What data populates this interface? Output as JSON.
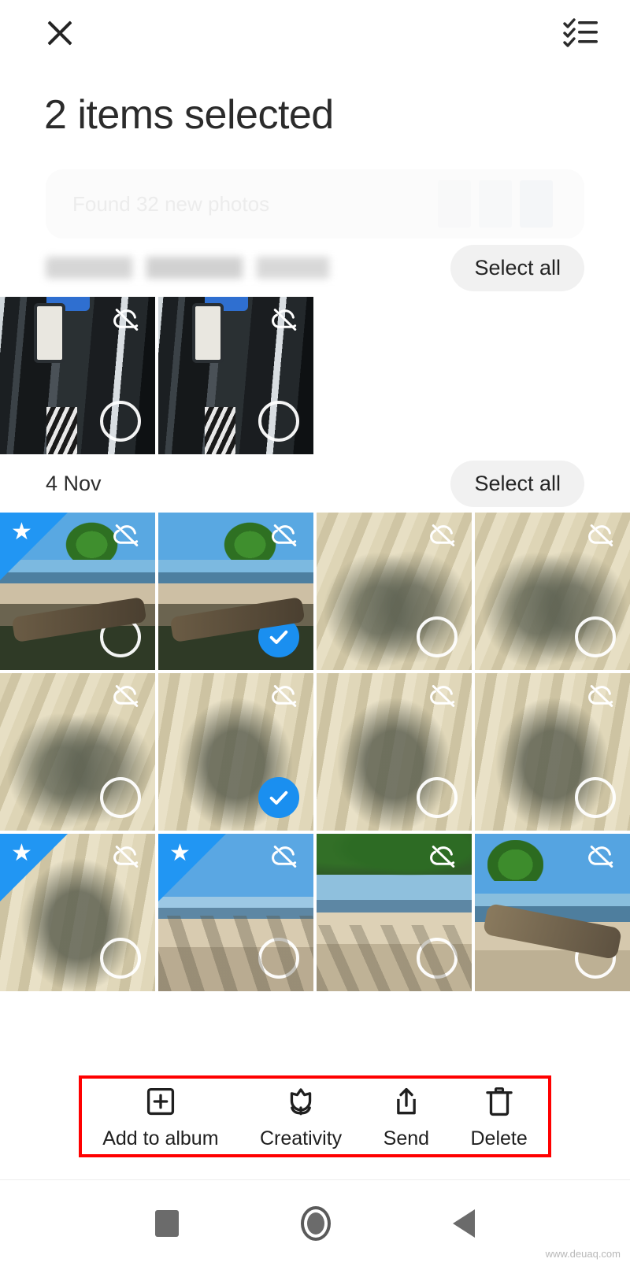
{
  "header": {
    "close_icon": "close-icon",
    "checklist_icon": "checklist-icon",
    "title": "2 items selected"
  },
  "banner": {
    "text": "Found 32 new photos"
  },
  "sections": [
    {
      "label": "",
      "label_blurred": true,
      "select_all_label": "Select all",
      "photos": [
        {
          "scene": "scene-port",
          "favorite": false,
          "cloud_off": true,
          "selected": false
        },
        {
          "scene": "scene-port",
          "favorite": false,
          "cloud_off": true,
          "selected": false
        }
      ]
    },
    {
      "label": "4 Nov",
      "label_blurred": false,
      "select_all_label": "Select all",
      "photos": [
        {
          "scene": "scene-tree",
          "favorite": true,
          "cloud_off": true,
          "selected": false
        },
        {
          "scene": "scene-tree",
          "favorite": false,
          "cloud_off": true,
          "selected": true
        },
        {
          "scene": "scene-shadow",
          "favorite": false,
          "cloud_off": true,
          "selected": false
        },
        {
          "scene": "scene-shadow",
          "favorite": false,
          "cloud_off": true,
          "selected": false
        },
        {
          "scene": "scene-shadow",
          "favorite": false,
          "cloud_off": true,
          "selected": false
        },
        {
          "scene": "scene-shadow1",
          "favorite": false,
          "cloud_off": true,
          "selected": true
        },
        {
          "scene": "scene-shadow1",
          "favorite": false,
          "cloud_off": true,
          "selected": false
        },
        {
          "scene": "scene-shadow1",
          "favorite": false,
          "cloud_off": true,
          "selected": false
        },
        {
          "scene": "scene-shadow1",
          "favorite": true,
          "cloud_off": true,
          "selected": false
        },
        {
          "scene": "scene-beach",
          "favorite": true,
          "cloud_off": true,
          "selected": false
        },
        {
          "scene": "scene-treeshade",
          "favorite": false,
          "cloud_off": true,
          "selected": false
        },
        {
          "scene": "scene-lonetree",
          "favorite": false,
          "cloud_off": true,
          "selected": false
        }
      ]
    }
  ],
  "actions": [
    {
      "icon": "add-to-album-icon",
      "label": "Add to album"
    },
    {
      "icon": "creativity-icon",
      "label": "Creativity"
    },
    {
      "icon": "send-icon",
      "label": "Send"
    },
    {
      "icon": "delete-icon",
      "label": "Delete"
    }
  ],
  "navbar": {
    "recents": "recents-square-icon",
    "home": "home-circle-icon",
    "back": "back-triangle-icon"
  },
  "watermark": "www.deuaq.com",
  "colors": {
    "accent_blue": "#1a8ff0",
    "favorite_blue": "#2196f3",
    "highlight_red": "#ff0000",
    "pill_bg": "#f1f1f1"
  }
}
